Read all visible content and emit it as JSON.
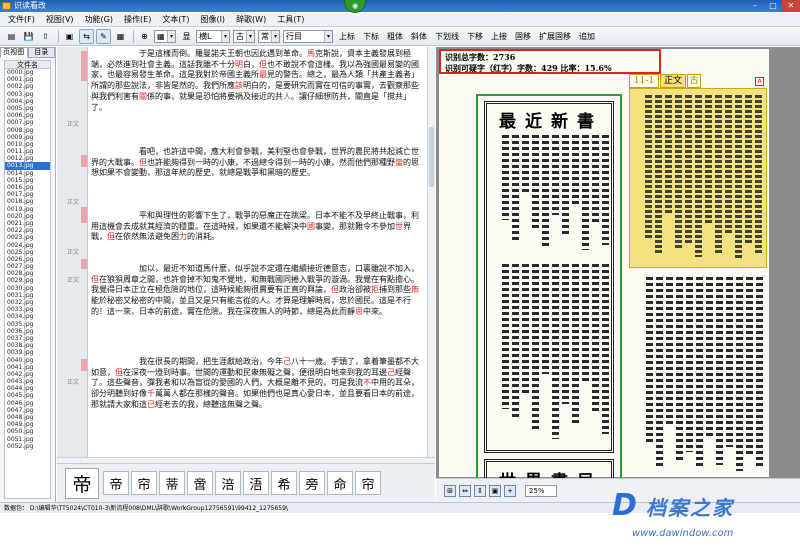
{
  "window": {
    "title": "识读看改"
  },
  "menu": [
    "文件(F)",
    "视图(V)",
    "功能(G)",
    "操作(E)",
    "文本(T)",
    "图像(I)",
    "辞歌(W)",
    "工具(T)"
  ],
  "toolbar": {
    "font_value": "横L",
    "font_style": "古",
    "kind": "常",
    "file_value": "行目",
    "buttons": [
      "显",
      "上标",
      "下标",
      "粗体",
      "斜体",
      "下划线",
      "下移",
      "上接",
      "固移",
      "扩展固移",
      "追加"
    ]
  },
  "left_panel": {
    "tabs": [
      "页视图",
      "目录"
    ],
    "column_header": "文件名",
    "selected": "0013.jpg",
    "files": [
      "0000.jpg",
      "0001.jpg",
      "0002.jpg",
      "0003.jpg",
      "0004.jpg",
      "0005.jpg",
      "0006.jpg",
      "0007.jpg",
      "0008.jpg",
      "0009.jpg",
      "0010.jpg",
      "0011.jpg",
      "0012.jpg",
      "0013.jpg",
      "0014.jpg",
      "0015.jpg",
      "0016.jpg",
      "0017.jpg",
      "0018.jpg",
      "0019.jpg",
      "0020.jpg",
      "0021.jpg",
      "0022.jpg",
      "0023.jpg",
      "0024.jpg",
      "0025.jpg",
      "0026.jpg",
      "0027.jpg",
      "0028.jpg",
      "0029.jpg",
      "0030.jpg",
      "0031.jpg",
      "0032.jpg",
      "0033.jpg",
      "0034.jpg",
      "0035.jpg",
      "0036.jpg",
      "0037.jpg",
      "0038.jpg",
      "0039.jpg",
      "0040.jpg",
      "0041.jpg",
      "0042.jpg",
      "0043.jpg",
      "0044.jpg",
      "0045.jpg",
      "0046.jpg",
      "0047.jpg",
      "0048.jpg",
      "0049.jpg",
      "0050.jpg",
      "0051.jpg",
      "0052.jpg"
    ]
  },
  "text_panel": {
    "margin_labels": [
      "正文",
      "正文",
      "正文",
      "正文",
      "正文"
    ],
    "paragraphs": [
      [
        "",
        "",
        "于是這樣而倒。羅曼諾夫王朝也因此遇到革命。",
        "r",
        "馬",
        "",
        "克斯說，資本主義發展到極端，必然進到社會主義。這話我雖不十分",
        "r",
        "明",
        "",
        "白，",
        "r",
        "但",
        "",
        "也不敢說不會這樣。我以為強國最易變的國家，也最容易發生革命。這是我對於帝國主義所",
        "r",
        "最",
        "",
        "見的警告。總之，最為人類「共產主義者」所謂的那些說法，非皆是然的。我們所應",
        "r",
        "該",
        "",
        "明白的，是要研究而實在可信的事實，去觀察那些與我們利害有",
        "r",
        "關",
        "",
        "係的事，就果是恐怕將要禍及接近的共",
        "r",
        "人",
        "",
        "。讓仔細想防共，關直是「搅共」了。"
      ],
      [
        "",
        "",
        "看吧，也許這中間，應大利會參戰，美利堅也會參戰，世界的農民將共起減亡世界的大戰事。",
        "r",
        "但",
        "",
        "也許能夠得到一時的小康，不過總令得到一時的小康，然而他們那種野",
        "r",
        "蠻",
        "",
        "的思想如果不會變動，那這年統的歷史，就總是戰爭和黑暗的歷史。"
      ],
      [
        "",
        "",
        "平和與理性的影響下生了，戰爭的惡魔正在跳梁。日本不能不及早終止戰事，利用這機會去成就其經濟的穩重。在這時候，如果還不能解決中",
        "r",
        "國",
        "",
        "事變，那就難令不參加",
        "r",
        "世",
        "",
        "界戰，",
        "r",
        "但",
        "",
        "在依然無法避免困",
        "r",
        "力",
        "",
        "的消耗。"
      ],
      [
        "",
        "",
        "加以，最近不知道馬什麼，似乎說不定還在繼續接近德意志，口裏雖說不加入，",
        "r",
        "但",
        "",
        "在狼狽周章之間，也許會掉不知鬼不覺地，和無戰國同捲入戰爭的漩渦。我覺在有點擔心。我覺得日本正立在極危險的地位，這時候能夠很賣要有正直的興論，",
        "r",
        "但",
        "",
        "政治卻被",
        "r",
        "拒",
        "",
        "捕到那些",
        "r",
        "無",
        "",
        "能於秘密又秘密的中間，並且又是只有能言從的人。才算是理解時局，忠於國民。這是不行的！這一來，日本的前途，實在危險。我在深夜無人的時節，總是為此而靜",
        "r",
        "思",
        "",
        "中來。"
      ],
      [
        "",
        "",
        "我在很長的期間，把生涯獻給政治，今年",
        "r",
        "己",
        "",
        "八十一歲。手頭了，拿着筆墨都不大如意，",
        "r",
        "但",
        "",
        "在深夜一燈到時事。世間的運動和民衆無礙之聲，便很明白地來到我的耳邊",
        "r",
        "己",
        "",
        "經聲了。這些聲音，彈我者和以為盲從的愛國的人們，大概是離不見的，可是我流",
        "r",
        "不",
        "",
        "中用的耳朵，卻分明聽到好像",
        "r",
        "千",
        "",
        "萬萬人都在那樣的聲音。如果他們也是真心愛日本，並且要看日本的前途，那就請大家和這",
        "r",
        "已",
        "",
        "經老去的我，總聽這無聲之聲。"
      ]
    ]
  },
  "char_strip": {
    "main": "帝",
    "candidates": [
      "帝",
      "帘",
      "蒂",
      "啻",
      "涪",
      "浯",
      "希",
      "旁",
      "命",
      "帘"
    ]
  },
  "image_panel": {
    "stats_line1": "识别总字数：2736",
    "stats_line2": "识别可疑字（红字）字数：429  比率：15.6%",
    "section_tag": "11-1",
    "type_tag": "正文",
    "variant_tag": "古",
    "mark": "A",
    "ad_title_top": "最近新書",
    "ad_title_bottom": "世界書局",
    "zoom": "25%"
  },
  "status": {
    "path": "数据包：  D:\\编辑华\\TT5024\\CT010-3\\新流程008\\DML\\辞歌\\WorkGroup12756591\\99412_1275659\\"
  },
  "watermark": {
    "brand": "档案之家",
    "url": "www.dawindow.com"
  }
}
